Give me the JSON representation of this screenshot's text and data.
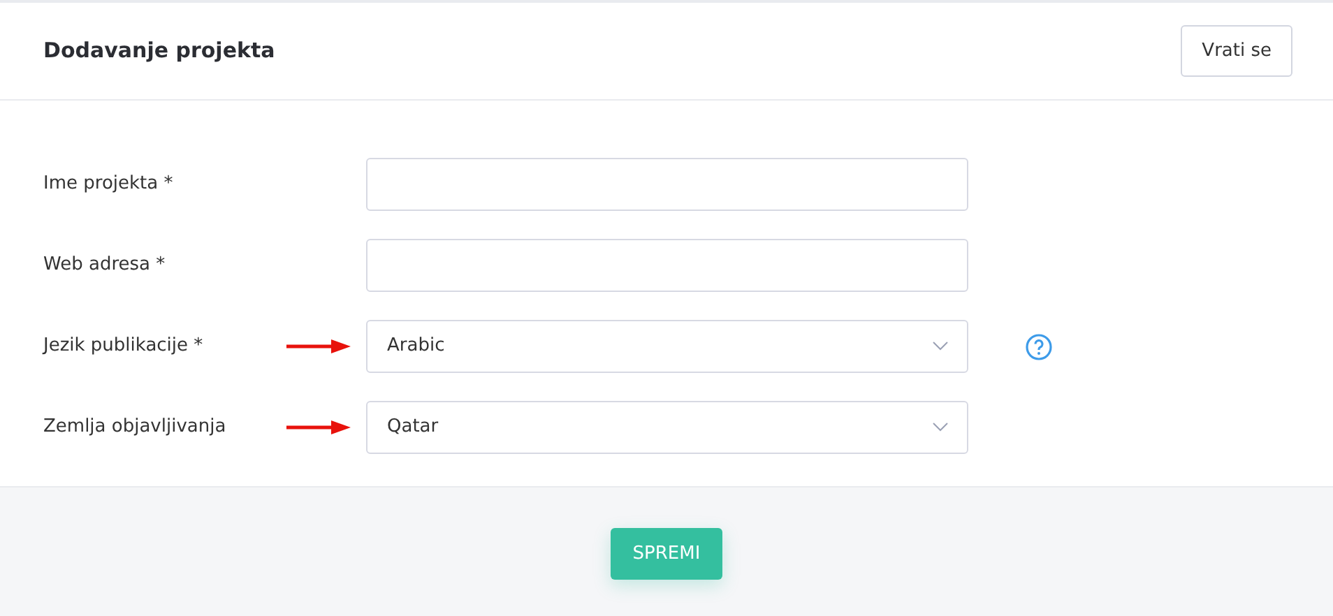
{
  "header": {
    "title": "Dodavanje projekta",
    "back_button": "Vrati se"
  },
  "fields": [
    {
      "kind": "text",
      "label": "Ime projekta *",
      "arrow": false,
      "help": false
    },
    {
      "kind": "text",
      "label": "Web adresa *",
      "arrow": false,
      "help": false
    },
    {
      "kind": "select",
      "label": "Jezik publikacije *",
      "value": "Arabic",
      "arrow": true,
      "help": true
    },
    {
      "kind": "select",
      "label": "Zemlja objavljivanja",
      "value": "Qatar",
      "arrow": true,
      "help": false
    }
  ],
  "footer": {
    "submit_button": "SPREMI"
  }
}
